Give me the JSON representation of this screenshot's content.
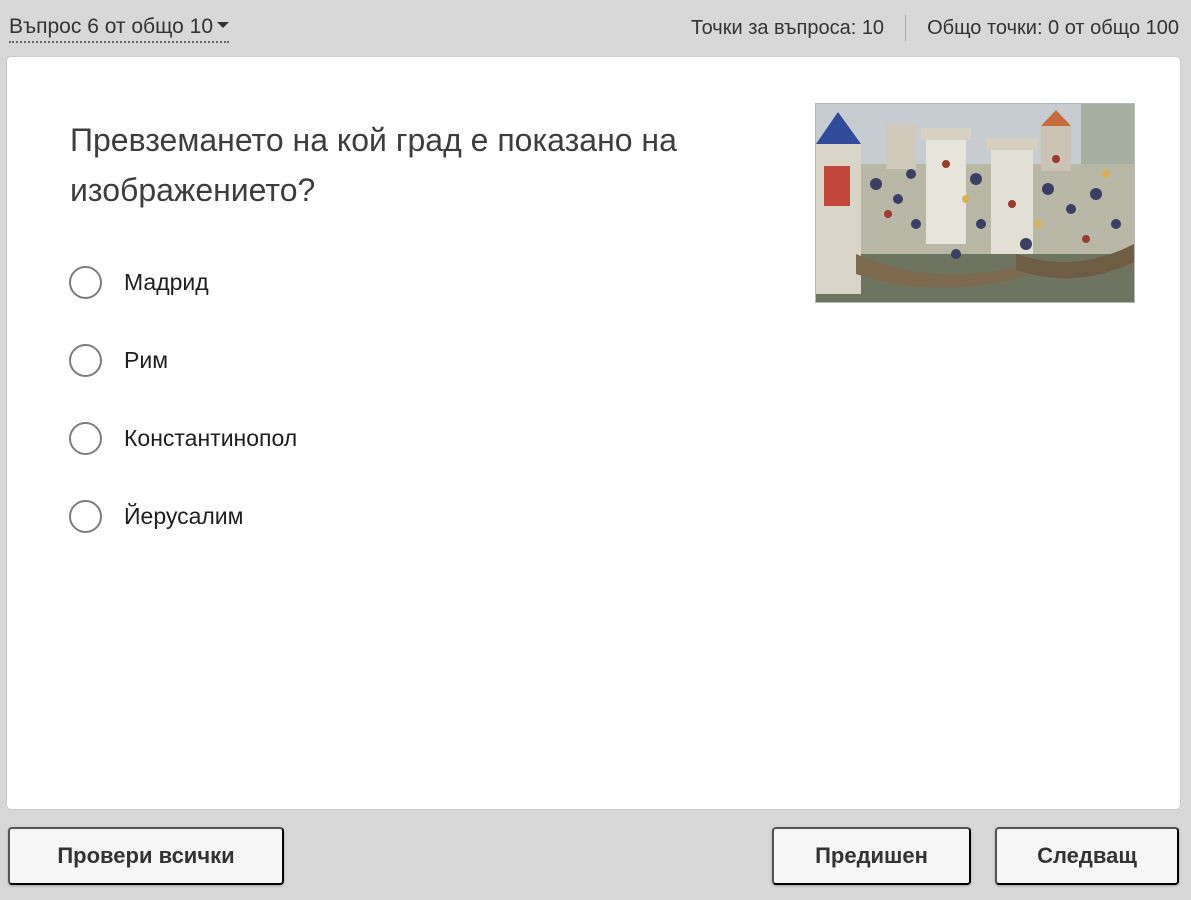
{
  "header": {
    "question_nav": "Въпрос 6 от общо 10",
    "question_points": "Точки за въпроса: 10",
    "total_points": "Общо точки: 0 от общо 100"
  },
  "question": {
    "text": "Превземането на кой град е показано на изображението?",
    "image_icon": "medieval-siege-painting"
  },
  "answers": [
    {
      "label": "Мадрид",
      "selected": false
    },
    {
      "label": "Рим",
      "selected": false
    },
    {
      "label": "Константинопол",
      "selected": false
    },
    {
      "label": "Йерусалим",
      "selected": false
    }
  ],
  "footer": {
    "check_all_label": "Провери всички",
    "prev_label": "Предишен",
    "next_label": "Следващ"
  }
}
